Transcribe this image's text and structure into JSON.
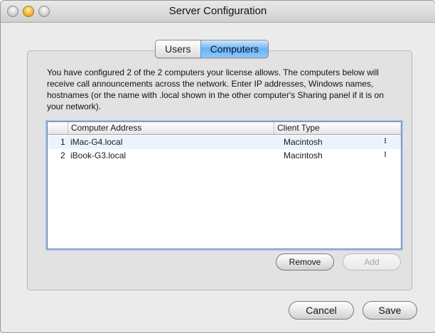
{
  "window": {
    "title": "Server Configuration"
  },
  "tabs": [
    {
      "label": "Users"
    },
    {
      "label": "Computers"
    }
  ],
  "description": "You have configured 2 of the 2 computers your license allows. The computers below will receive call announcements across the network. Enter IP addresses, Windows names, hostnames (or the name with .local shown in the other computer's Sharing panel if it is on your network).",
  "table": {
    "columns": {
      "address": "Computer Address",
      "client_type": "Client Type"
    },
    "rows": [
      {
        "index": "1",
        "address": "iMac-G4.local",
        "client_type": "Macintosh"
      },
      {
        "index": "2",
        "address": "iBook-G3.local",
        "client_type": "Macintosh"
      }
    ]
  },
  "buttons": {
    "remove": "Remove",
    "add": "Add",
    "cancel": "Cancel",
    "save": "Save"
  },
  "icons": {
    "stepper": "⁝"
  },
  "colors": {
    "accent": "#6cb2f2",
    "table_focus": "#9fc2ec"
  }
}
